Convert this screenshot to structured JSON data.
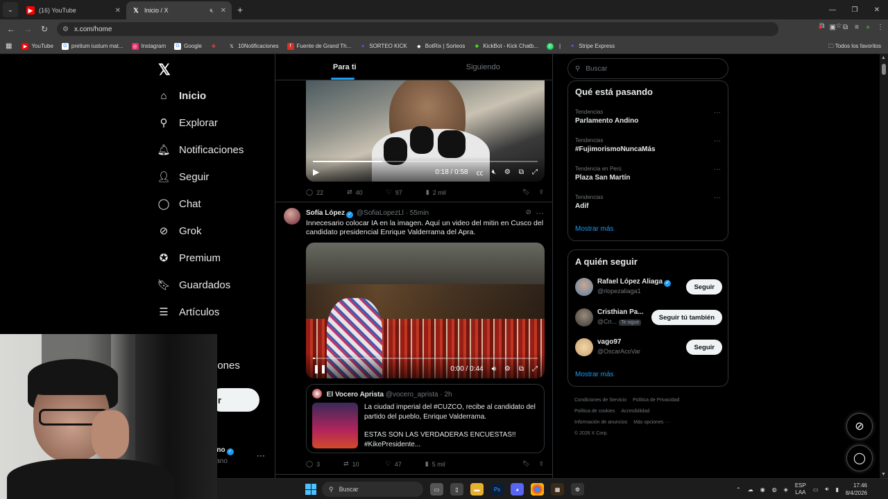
{
  "browser": {
    "tabs": [
      {
        "title": "(16) YouTube",
        "icon": "youtube-icon",
        "active": false
      },
      {
        "title": "Inicio / X",
        "icon": "x-icon",
        "active": true
      }
    ],
    "url": "x.com/home",
    "bookmarks": [
      {
        "label": "YouTube",
        "icon": "youtube-icon",
        "color": "#ff0000"
      },
      {
        "label": "pretium iustum mat...",
        "icon": "google-icon",
        "color": "#ffffff"
      },
      {
        "label": "Instagram",
        "icon": "instagram-icon",
        "color": "#e1306c"
      },
      {
        "label": "Google",
        "icon": "google-icon",
        "color": "#ffffff"
      },
      {
        "label": "",
        "icon": "pinwheel-icon",
        "color": "#ea4335"
      },
      {
        "label": "10Notificaciones",
        "icon": "x-icon",
        "color": "#000000"
      },
      {
        "label": "Fuente de Grand Th...",
        "icon": "font-icon",
        "color": "#d93025"
      },
      {
        "label": "SORTEO KICK",
        "icon": "kick-icon",
        "color": "#9146ff"
      },
      {
        "label": "BotRix | Sorteos",
        "icon": "botrix-icon",
        "color": "#ffffff"
      },
      {
        "label": "KickBot - Kick Chatb...",
        "icon": "kickbot-icon",
        "color": "#53fc18"
      },
      {
        "label": "",
        "icon": "whatsapp-icon",
        "color": "#25d366"
      },
      {
        "label": "|",
        "icon": "",
        "color": ""
      },
      {
        "label": "Stripe Express",
        "icon": "stripe-icon",
        "color": "#635bff"
      }
    ],
    "bookmarks_right": "Todos los favoritos"
  },
  "nav": {
    "items": [
      {
        "label": "Inicio",
        "icon": "home-icon",
        "bold": true
      },
      {
        "label": "Explorar",
        "icon": "search-icon"
      },
      {
        "label": "Notificaciones",
        "icon": "bell-icon"
      },
      {
        "label": "Seguir",
        "icon": "add-person-icon"
      },
      {
        "label": "Chat",
        "icon": "chat-icon"
      },
      {
        "label": "Grok",
        "icon": "grok-icon"
      },
      {
        "label": "Premium",
        "icon": "premium-icon"
      },
      {
        "label": "Guardados",
        "icon": "bookmark-icon"
      },
      {
        "label": "Artículos",
        "icon": "articles-icon"
      }
    ],
    "partial_item": "iones",
    "post_button_partial": "r",
    "account_name_partial": "iano",
    "account_handle_partial": "ciano"
  },
  "feed": {
    "tabs": [
      "Para ti",
      "Siguiendo"
    ],
    "tweet1": {
      "video_time": "0:18 / 0:58",
      "video_progress": 0.31,
      "replies": "22",
      "reposts": "40",
      "likes": "97",
      "views": "2 mil"
    },
    "tweet2": {
      "name": "Sofía López",
      "handle": "@SofiaLopezLl",
      "time": "· 55min",
      "text": "Innecesario colocar IA en la imagen. Aquí un video del mitin en Cusco del candidato presidencial Enrique Valderrama del Apra.",
      "video_time": "0:00 / 0:44",
      "video_progress": 0.01,
      "quote": {
        "name": "El Vocero Aprista",
        "handle": "@vocero_aprista",
        "time": "· 2h",
        "text1": "La ciudad imperial del #CUZCO, recibe al candidato del partido del pueblo, Enrique Valderrama.",
        "text2": "ESTAS SON LAS VERDADERAS ENCUESTAS!! #KikePresidente..."
      },
      "replies": "3",
      "reposts": "10",
      "likes": "47",
      "views": "5 mil"
    }
  },
  "sidebar": {
    "search_placeholder": "Buscar",
    "trends_title": "Qué está pasando",
    "trends": [
      {
        "context": "Tendencias",
        "title": "Parlamento Andino"
      },
      {
        "context": "Tendencias",
        "title": "#FujimorismoNuncaMás"
      },
      {
        "context": "Tendencia en Perú",
        "title": "Plaza San Martín"
      },
      {
        "context": "Tendencias",
        "title": "Adif"
      }
    ],
    "show_more": "Mostrar más",
    "follow_title": "A quién seguir",
    "follows": [
      {
        "name": "Rafael López Aliaga",
        "handle": "@rlopezaliaga1",
        "verified": true,
        "badge": "",
        "button": "Seguir",
        "color": "#5b7ea6"
      },
      {
        "name": "Cristhian Pa...",
        "handle": "@Cri...",
        "verified": false,
        "badge": "Te sigue",
        "button": "Seguir tú también",
        "color": "#7a6a5a"
      },
      {
        "name": "vago97",
        "handle": "@OscarAcoVar",
        "verified": false,
        "badge": "",
        "button": "Seguir",
        "color": "#c9a070"
      }
    ],
    "follow_show_more": "Mostrar más",
    "footer": [
      "Condiciones de Servicio",
      "Política de Privacidad",
      "Política de cookies",
      "Accesibilidad",
      "Información de anuncios",
      "Más opciones ···",
      "© 2026 X Corp."
    ]
  },
  "taskbar": {
    "search_label": "Buscar",
    "lang": "ESP",
    "lang2": "LAA",
    "time": "17:46",
    "date": "8/4/2026"
  }
}
